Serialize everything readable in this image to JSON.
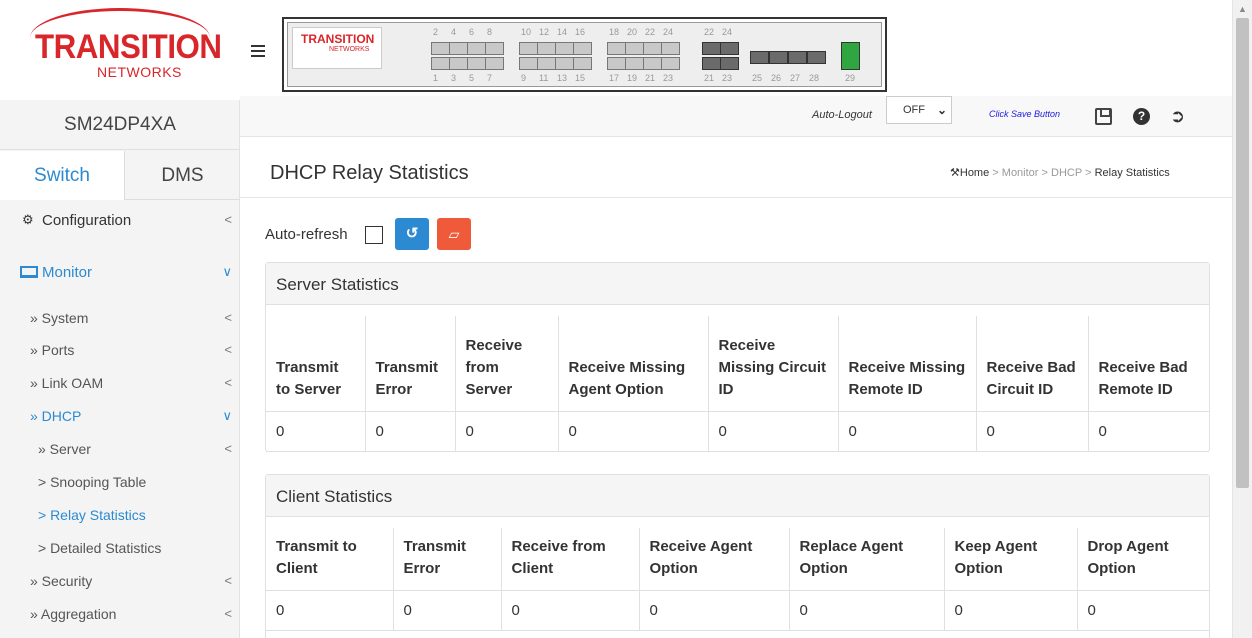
{
  "brand": {
    "name_line1": "TRANSITION",
    "name_line2": "NETWORKS"
  },
  "sidebar": {
    "device_name": "SM24DP4XA",
    "tabs": [
      {
        "label": "Switch",
        "active": true
      },
      {
        "label": "DMS",
        "active": false
      }
    ],
    "items": [
      {
        "label": "Configuration",
        "icon": "gear-icon",
        "chevron": "<"
      },
      {
        "label": "Monitor",
        "icon": "laptop-icon",
        "chevron": "∨"
      },
      {
        "label": "» System",
        "chevron": "<"
      },
      {
        "label": "» Ports",
        "chevron": "<"
      },
      {
        "label": "» Link OAM",
        "chevron": "<"
      },
      {
        "label": "» DHCP",
        "chevron": "∨"
      },
      {
        "label": "» Server",
        "chevron": "<"
      },
      {
        "label": "> Snooping Table"
      },
      {
        "label": "> Relay Statistics"
      },
      {
        "label": "> Detailed Statistics"
      },
      {
        "label": "» Security",
        "chevron": "<"
      },
      {
        "label": "» Aggregation",
        "chevron": "<"
      }
    ]
  },
  "switch_panel": {
    "logo": {
      "line1": "TRANSITION",
      "line2": "NETWORKS"
    },
    "top_numbers": [
      "2",
      "4",
      "6",
      "8",
      "10",
      "12",
      "14",
      "16",
      "18",
      "20",
      "22",
      "24",
      "22",
      "24"
    ],
    "bottom_numbers": [
      "1",
      "3",
      "5",
      "7",
      "9",
      "11",
      "13",
      "15",
      "17",
      "19",
      "21",
      "23",
      "21",
      "23",
      "25",
      "26",
      "27",
      "28",
      "29"
    ]
  },
  "infobar": {
    "autologout_label": "Auto-Logout",
    "autologout_value": "OFF",
    "save_label": "Click Save Button"
  },
  "page": {
    "title": "DHCP Relay Statistics",
    "breadcrumb": {
      "home": "Home",
      "sep": ">",
      "items": [
        "Monitor",
        "DHCP"
      ],
      "current": "Relay Statistics"
    }
  },
  "controls": {
    "autorefresh_label": "Auto-refresh"
  },
  "server_stats": {
    "title": "Server Statistics",
    "headers": [
      "Transmit to Server",
      "Transmit Error",
      "Receive from Server",
      "Receive Missing Agent Option",
      "Receive Missing Circuit ID",
      "Receive Missing Remote ID",
      "Receive Bad Circuit ID",
      "Receive Bad Remote ID"
    ],
    "values": [
      "0",
      "0",
      "0",
      "0",
      "0",
      "0",
      "0",
      "0"
    ]
  },
  "client_stats": {
    "title": "Client Statistics",
    "headers": [
      "Transmit to Client",
      "Transmit Error",
      "Receive from Client",
      "Receive Agent Option",
      "Replace Agent Option",
      "Keep Agent Option",
      "Drop Agent Option"
    ],
    "values": [
      "0",
      "0",
      "0",
      "0",
      "0",
      "0",
      "0"
    ]
  },
  "colors": {
    "accent": "#2b8ad1",
    "brand_red": "#d8262a",
    "clear_button": "#ef5a3a"
  }
}
